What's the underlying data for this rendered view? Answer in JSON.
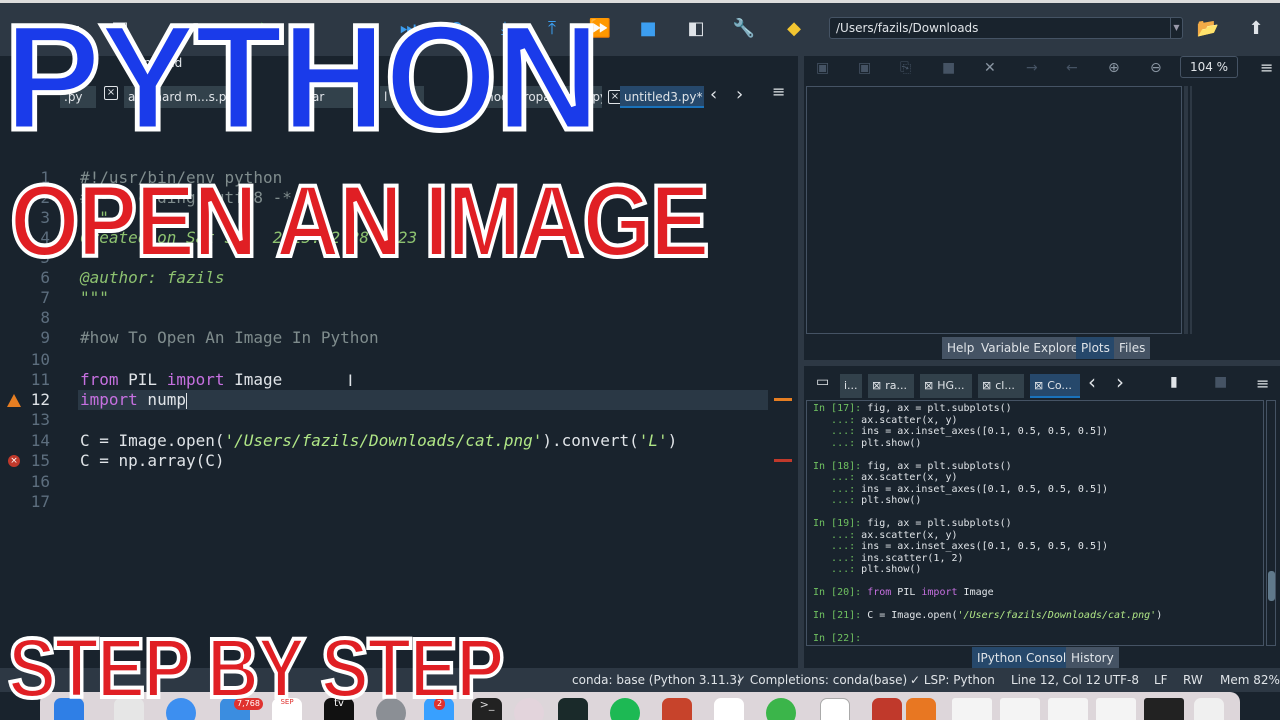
{
  "toolbar": {
    "working_dir": "/Users/fazils/Downloads",
    "icons": [
      "new-file-icon",
      "save-icon",
      "run-icon",
      "run-cell-icon",
      "step-into-icon",
      "step-over-icon",
      "step-out-icon",
      "continue-icon",
      "stop-icon",
      "maximize-pane-icon",
      "preferences-wrench-icon",
      "python-path-icon",
      "browse-folder-icon",
      "parent-dir-icon"
    ]
  },
  "editor": {
    "breadcrumb": "untitled",
    "tabs": [
      {
        "label": ".py"
      },
      {
        "label": "adamard m...s.py"
      },
      {
        "label": "ar"
      },
      {
        "label": "l b"
      },
      {
        "label": "modepropagation.py"
      },
      {
        "label": "untitled3.py*",
        "active": true
      }
    ],
    "line_numbers": [
      "1",
      "2",
      "3",
      "4",
      "5",
      "6",
      "7",
      "8",
      "9",
      "10",
      "11",
      "12",
      "13",
      "14",
      "15",
      "16",
      "17"
    ],
    "current_line": "12",
    "lines": {
      "l1": "#!/usr/bin/env python",
      "l2": "# -*- coding: utf-8 -*-",
      "l3": "\"\"\"",
      "l4": "Created on Sat Sep  2 15:52:28 2023",
      "l6": "@author: fazils",
      "l7": "\"\"\"",
      "l9": "#how To Open An Image In Python",
      "l11_kw1": "from",
      "l11_a": " PIL ",
      "l11_kw2": "import",
      "l11_b": " Image",
      "l12_kw": "import",
      "l12_a": " nump",
      "l14_a": "C = Image.open(",
      "l14_str": "'/Users/fazils/Downloads/cat.png'",
      "l14_b": ").convert(",
      "l14_str2": "'L'",
      "l14_c": ")",
      "l15": "C = np.array(C)"
    }
  },
  "plots": {
    "zoom": "104 %",
    "tabs": [
      "Help",
      "Variable Explorer",
      "Plots",
      "Files"
    ],
    "active_tab": "Plots"
  },
  "console": {
    "tabs": [
      "i...",
      "ra...",
      "HG...",
      "cl...",
      "Co..."
    ],
    "bottom_tabs": [
      "IPython Console",
      "History"
    ],
    "active_bottom_tab": "IPython Console",
    "lines": [
      {
        "p": "In [17]:",
        "t": " fig, ax = plt.subplots()"
      },
      {
        "p": "   ...:",
        "t": " ax.scatter(x, y)"
      },
      {
        "p": "   ...:",
        "t": " ins = ax.inset_axes([0.1, 0.5, 0.5, 0.5])"
      },
      {
        "p": "   ...:",
        "t": " plt.show()"
      },
      {
        "p": "",
        "t": ""
      },
      {
        "p": "In [18]:",
        "t": " fig, ax = plt.subplots()"
      },
      {
        "p": "   ...:",
        "t": " ax.scatter(x, y)"
      },
      {
        "p": "   ...:",
        "t": " ins = ax.inset_axes([0.1, 0.5, 0.5, 0.5])"
      },
      {
        "p": "   ...:",
        "t": " plt.show()"
      },
      {
        "p": "",
        "t": ""
      },
      {
        "p": "In [19]:",
        "t": " fig, ax = plt.subplots()"
      },
      {
        "p": "   ...:",
        "t": " ax.scatter(x, y)"
      },
      {
        "p": "   ...:",
        "t": " ins = ax.inset_axes([0.1, 0.5, 0.5, 0.5])"
      },
      {
        "p": "   ...:",
        "t": " ins.scatter(1, 2)"
      },
      {
        "p": "   ...:",
        "t": " plt.show()"
      },
      {
        "p": "",
        "t": ""
      },
      {
        "p": "In [20]:",
        "kw1": " from",
        "t": " PIL",
        "kw2": " import",
        "t2": " Image"
      },
      {
        "p": "",
        "t": ""
      },
      {
        "p": "In [21]:",
        "t": " C = Image.open(",
        "s": "'/Users/fazils/Downloads/cat.png'",
        "t2": ")"
      },
      {
        "p": "",
        "t": ""
      },
      {
        "p": "In [22]:",
        "t": ""
      }
    ]
  },
  "status": {
    "env": "conda: base (Python 3.11.3)",
    "completions": "Completions: conda(base)",
    "lsp": "LSP: Python",
    "position": "Line 12, Col 12",
    "encoding": "UTF-8",
    "eol": "LF",
    "rw": "RW",
    "mem": "Mem 82%"
  },
  "dock": {
    "calendar_month": "SEP",
    "calendar_day": "2",
    "mail_badge": "7,768",
    "messages_badge": "2",
    "tv_label": "tv"
  },
  "overlay": {
    "title1": "PYTHON",
    "title2": "OPEN AN IMAGE",
    "title3": "STEP BY STEP"
  },
  "colors": {
    "accent": "#1a72bb",
    "background": "#19232d",
    "keyword": "#c670e0",
    "string": "#b0e686",
    "warning": "#e67e22",
    "error": "#c0392b",
    "overlay_blue": "#1a3bea",
    "overlay_red": "#e01f24"
  }
}
